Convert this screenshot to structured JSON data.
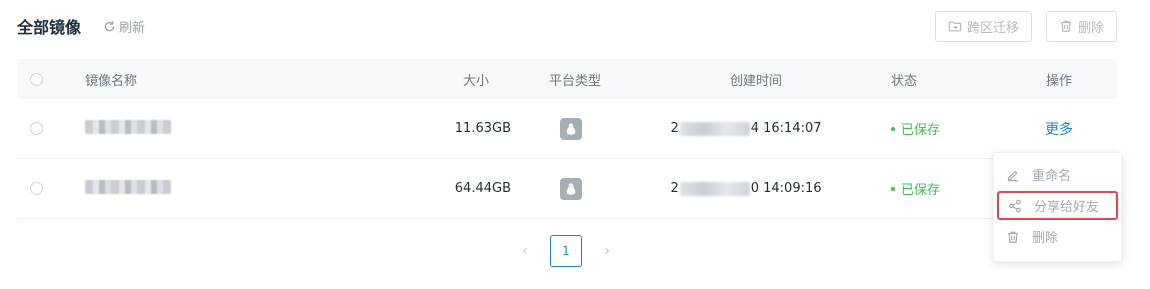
{
  "header": {
    "title": "全部镜像",
    "refresh_label": "刷新",
    "migrate_label": "跨区迁移",
    "delete_label": "删除"
  },
  "table": {
    "columns": {
      "name": "镜像名称",
      "size": "大小",
      "platform": "平台类型",
      "created": "创建时间",
      "status": "状态",
      "ops": "操作"
    },
    "rows": [
      {
        "size": "11.63GB",
        "time_prefix": "2",
        "time_suffix": "4 16:14:07",
        "status": "已保存",
        "more": "更多",
        "platform_icon": "linux-penguin-icon"
      },
      {
        "size": "64.44GB",
        "time_prefix": "2",
        "time_suffix": "0 14:09:16",
        "status": "已保存",
        "more": "更多",
        "platform_icon": "linux-penguin-icon"
      }
    ]
  },
  "pagination": {
    "current": "1",
    "prev_icon": "chevron-left-icon",
    "next_icon": "chevron-right-icon"
  },
  "menu": {
    "items": [
      {
        "label": "重命名",
        "icon": "edit-icon"
      },
      {
        "label": "分享给好友",
        "icon": "share-icon"
      },
      {
        "label": "删除",
        "icon": "trash-icon"
      }
    ]
  },
  "colors": {
    "accent": "#1b8ad6",
    "status_ok": "#3ec04c",
    "highlight": "#e8424f"
  }
}
